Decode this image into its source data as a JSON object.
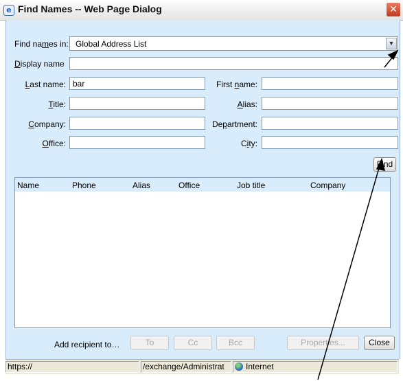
{
  "window": {
    "title": "Find Names -- Web Page Dialog",
    "close_glyph": "✕"
  },
  "find_names_in": {
    "label_pre": "Find na",
    "label_key": "m",
    "label_post": "es in:",
    "value": "Global Address List"
  },
  "fields": {
    "display_name": {
      "key": "D",
      "rest": "isplay name",
      "value": ""
    },
    "last_name": {
      "key": "L",
      "rest": "ast name:",
      "value": "bar"
    },
    "first_name": {
      "pre": "First ",
      "key": "n",
      "rest": "ame:",
      "value": ""
    },
    "title": {
      "key": "T",
      "rest": "itle:",
      "value": ""
    },
    "alias": {
      "key": "A",
      "rest": "lias:",
      "value": ""
    },
    "company": {
      "key": "C",
      "rest": "ompany:",
      "value": ""
    },
    "department": {
      "pre": "De",
      "key": "p",
      "rest": "artment:",
      "value": ""
    },
    "office": {
      "key": "O",
      "rest": "ffice:",
      "value": ""
    },
    "city": {
      "pre": "C",
      "key": "i",
      "rest": "ty:",
      "value": ""
    }
  },
  "find_button": {
    "key": "F",
    "rest": "ind"
  },
  "results": {
    "columns": [
      "Name",
      "Phone",
      "Alias",
      "Office",
      "Job title",
      "Company"
    ],
    "rows": []
  },
  "footer": {
    "add_recipient": "Add recipient to…",
    "to": "To",
    "cc": "Cc",
    "bcc": "Bcc",
    "properties": "Properties...",
    "close": "Close"
  },
  "status_bar": {
    "url": "https://",
    "path": "/exchange/Administrat",
    "zone": "Internet"
  },
  "colors": {
    "dialog_bg": "#d9ecfb",
    "close_red": "#c3381a",
    "status_bg": "#ece9d8"
  }
}
